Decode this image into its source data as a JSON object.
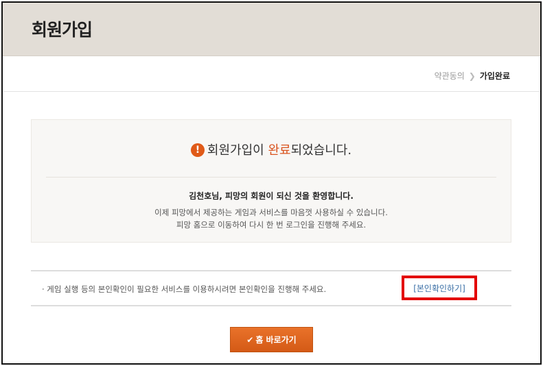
{
  "header": {
    "title": "회원가입"
  },
  "steps": {
    "prev": "약관동의",
    "current": "가입완료"
  },
  "result": {
    "message_before": "회원가입이 ",
    "message_accent": "완료",
    "message_after": "되었습니다.",
    "welcome": "김천호님, 피망의 회원이 되신 것을 환영합니다.",
    "desc_line1": "이제 피망에서 제공하는 게임과 서비스를 마음껏 사용하실 수 있습니다.",
    "desc_line2": "피망 홈으로 이동하여 다시 한 번 로그인을 진행해 주세요."
  },
  "notice": {
    "text": "· 게임 실행 등의 본인확인이 필요한 서비스를 이용하시려면 본인확인을 진행해 주세요.",
    "link_label": "[본인확인하기]"
  },
  "home_button": {
    "label": "홈 바로가기"
  },
  "colors": {
    "accent": "#d9531e",
    "header_bg": "#e2ddd6",
    "button": "#e0641f",
    "highlight_border": "#e30000"
  }
}
